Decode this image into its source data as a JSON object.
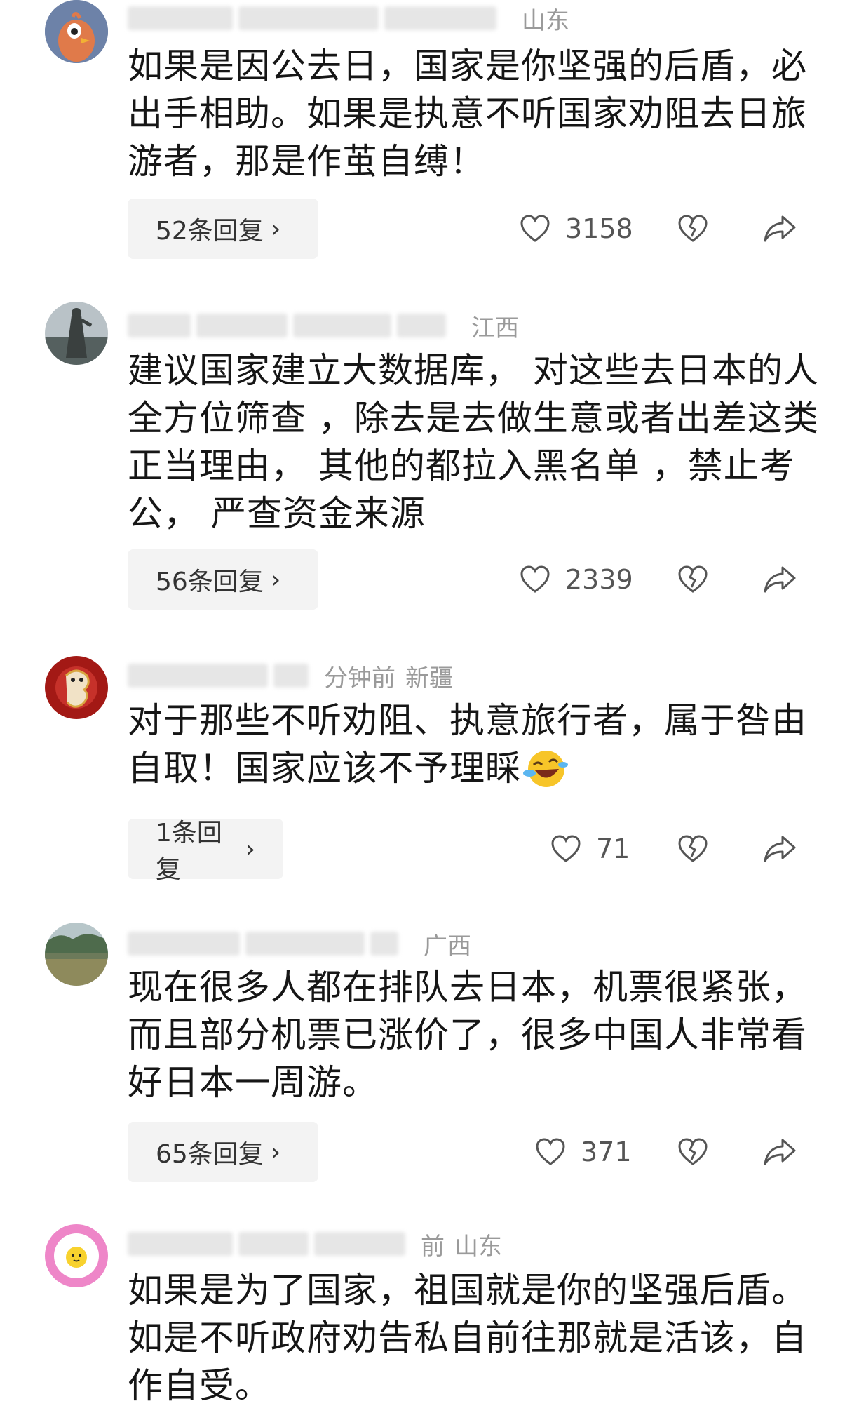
{
  "comments": [
    {
      "meta_time": "",
      "meta_location": "山东",
      "text": "如果是因公去日，国家是你坚强的后盾，必出手相助。如果是执意不听国家劝阻去日旅游者，那是作茧自缚！",
      "replies": "52条回复",
      "likes": "3158",
      "avatar": "bird-avatar"
    },
    {
      "meta_time": "",
      "meta_location": "江西",
      "text": "建议国家建立大数据库， 对这些去日本的人全方位筛查 ，除去是去做生意或者出差这类正当理由， 其他的都拉入黑名单 ，禁止考公， 严查资金来源",
      "replies": "56条回复",
      "likes": "2339",
      "avatar": "statue-avatar"
    },
    {
      "meta_time": "分钟前",
      "meta_location": "新疆",
      "text": "对于那些不听劝阻、执意旅行者，属于咎由自取！国家应该不予理睬",
      "replies": "1条回复",
      "likes": "71",
      "avatar": "dragon-avatar"
    },
    {
      "meta_time": "",
      "meta_location": "广西",
      "text": "现在很多人都在排队去日本，机票很紧张，而且部分机票已涨价了，很多中国人非常看好日本一周游。",
      "replies": "65条回复",
      "likes": "371",
      "avatar": "landscape-avatar"
    },
    {
      "meta_time": "前",
      "meta_location": "山东",
      "text": "如果是为了国家，祖国就是你的坚强后盾。如是不听政府劝告私自前往那就是活该，自作自受。",
      "avatar": "egg-avatar"
    }
  ],
  "chevron": "›"
}
